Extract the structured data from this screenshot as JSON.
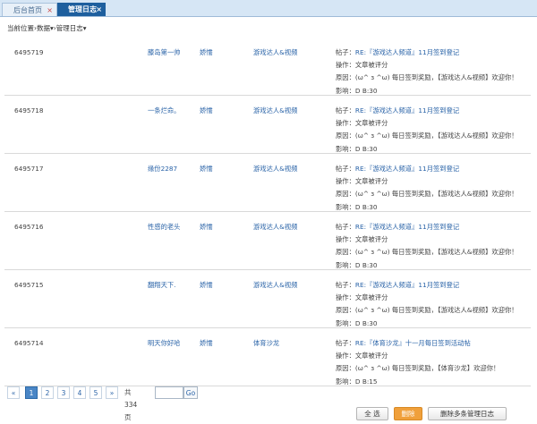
{
  "tabs": [
    {
      "label": "后台首页",
      "close": "×"
    },
    {
      "label": "管理日志",
      "close": "×"
    }
  ],
  "breadcrumb": [
    "当前位置",
    "›",
    "数据",
    "▾",
    "›",
    "管理日志",
    "▾"
  ],
  "rows": [
    {
      "id": "6495719",
      "user": "膝岛第一帅",
      "action": "娇懦",
      "forum": "游戏达人&视频",
      "post_prefix": "帖子：",
      "post_link": "RE:『游戏达人频道』11月签到登记",
      "op": "操作：文章被评分",
      "reason": "原因：(ω^ з ^ω) 每日签到奖励，【游戏达人&视频】欢迎你！",
      "effect": "影响：D B:30"
    },
    {
      "id": "6495718",
      "user": "一条烂命。",
      "action": "娇懦",
      "forum": "游戏达人&视频",
      "post_prefix": "帖子：",
      "post_link": "RE:『游戏达人频道』11月签到登记",
      "op": "操作：文章被评分",
      "reason": "原因：(ω^ з ^ω) 每日签到奖励，【游戏达人&视频】欢迎你！",
      "effect": "影响：D B:30"
    },
    {
      "id": "6495717",
      "user": "缘份2287",
      "action": "娇懦",
      "forum": "游戏达人&视频",
      "post_prefix": "帖子：",
      "post_link": "RE:『游戏达人频道』11月签到登记",
      "op": "操作：文章被评分",
      "reason": "原因：(ω^ з ^ω) 每日签到奖励，【游戏达人&视频】欢迎你！",
      "effect": "影响：D B:30"
    },
    {
      "id": "6495716",
      "user": "性感的老头",
      "action": "娇懦",
      "forum": "游戏达人&视频",
      "post_prefix": "帖子：",
      "post_link": "RE:『游戏达人频道』11月签到登记",
      "op": "操作：文章被评分",
      "reason": "原因：(ω^ з ^ω) 每日签到奖励，【游戏达人&视频】欢迎你！",
      "effect": "影响：D B:30"
    },
    {
      "id": "6495715",
      "user": "翻翔天下.",
      "action": "娇懦",
      "forum": "游戏达人&视频",
      "post_prefix": "帖子：",
      "post_link": "RE:『游戏达人频道』11月签到登记",
      "op": "操作：文章被评分",
      "reason": "原因：(ω^ з ^ω) 每日签到奖励，【游戏达人&视频】欢迎你！",
      "effect": "影响：D B:30"
    },
    {
      "id": "6495714",
      "user": "明天你好哈",
      "action": "娇懦",
      "forum": "体育沙龙",
      "post_prefix": "帖子：",
      "post_link": "RE:『体育沙龙』十一月每日签到活动帖",
      "op": "操作：文章被评分",
      "reason": "原因：(ω^ з ^ω) 每日签到奖励，【体育沙龙】欢迎你！",
      "effect": "影响：D B:15"
    }
  ],
  "pager": {
    "prev": "«",
    "pages": [
      "1",
      "2",
      "3",
      "4",
      "5"
    ],
    "current": "1",
    "next": "»",
    "total": "共334页",
    "go": "Go",
    "go_value": ""
  },
  "buttons": {
    "select_all": "全 选",
    "delete": "删除",
    "delete_multi": "删除多条管理日志"
  },
  "colors": {
    "link": "#2b64a8",
    "active_tab": "#1e5f9e",
    "delete_button": "#f0a03b",
    "active_page": "#4a86c6"
  }
}
